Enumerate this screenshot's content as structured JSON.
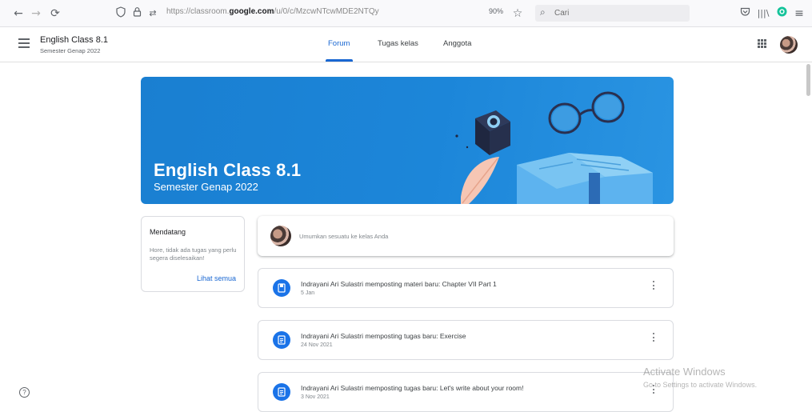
{
  "browser": {
    "url_prefix": "https://classroom.",
    "url_domain": "google.com",
    "url_path": "/u/0/c/MzcwNTcwMDE2NTQy",
    "zoom": "90%",
    "search_placeholder": "Cari",
    "icons": [
      "back-arrow-icon",
      "forward-arrow-icon",
      "reload-icon",
      "shield-icon",
      "lock-icon",
      "permissions-icon",
      "star-icon",
      "pocket-icon",
      "library-icon",
      "grammarly-icon",
      "menu-icon"
    ]
  },
  "header": {
    "class_name": "English Class 8.1",
    "semester": "Semester Genap 2022",
    "tabs": [
      {
        "label": "Forum",
        "active": true
      },
      {
        "label": "Tugas kelas",
        "active": false
      },
      {
        "label": "Anggota",
        "active": false
      }
    ]
  },
  "banner": {
    "title": "English Class 8.1",
    "subtitle": "Semester Genap 2022",
    "color": "#1a7fd1"
  },
  "upcoming": {
    "heading": "Mendatang",
    "message": "Hore, tidak ada tugas yang perlu segera diselesaikan!",
    "link": "Lihat semua"
  },
  "announce": {
    "placeholder": "Umumkan sesuatu ke kelas Anda"
  },
  "posts": [
    {
      "title": "Indrayani Ari Sulastri memposting materi baru: Chapter VII Part 1",
      "date": "5 Jan",
      "icon": "material-icon"
    },
    {
      "title": "Indrayani Ari Sulastri memposting tugas baru: Exercise",
      "date": "24 Nov 2021",
      "icon": "assignment-icon"
    },
    {
      "title": "Indrayani Ari Sulastri memposting tugas baru: Let's write about your room!",
      "date": "3 Nov 2021",
      "icon": "assignment-icon"
    }
  ],
  "watermark": {
    "title": "Activate Windows",
    "subtitle": "Go to Settings to activate Windows."
  },
  "accent_color": "#1967d2"
}
